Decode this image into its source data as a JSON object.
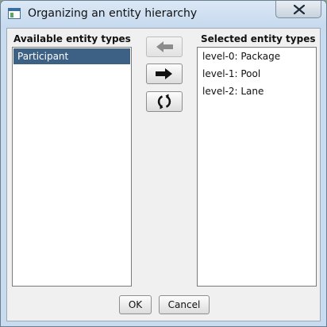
{
  "window": {
    "title": "Organizing an entity hierarchy",
    "icon": "app-window-icon",
    "close_icon": "close-icon"
  },
  "available": {
    "label": "Available entity types",
    "items": [
      {
        "label": "Participant",
        "selected": true
      }
    ]
  },
  "selected": {
    "label": "Selected entity types",
    "items": [
      {
        "label": "level-0: Package"
      },
      {
        "label": "level-1: Pool"
      },
      {
        "label": "level-2: Lane"
      }
    ]
  },
  "transfer": {
    "remove_icon": "arrow-left-icon",
    "remove_enabled": false,
    "add_icon": "arrow-right-icon",
    "add_enabled": true,
    "reset_icon": "refresh-icon",
    "reset_enabled": true
  },
  "footer": {
    "ok_label": "OK",
    "cancel_label": "Cancel"
  },
  "colors": {
    "selection": "#3d6185",
    "title_bar": "#c9dcef"
  }
}
